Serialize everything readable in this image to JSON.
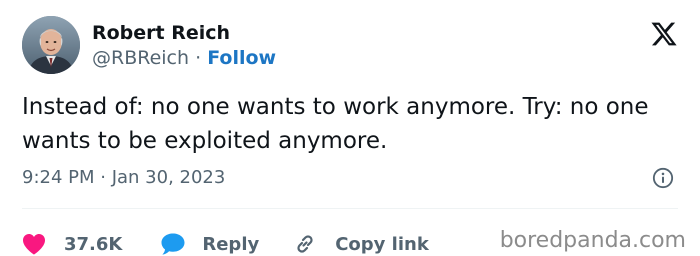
{
  "author": {
    "name": "Robert Reich",
    "handle": "@RBReich",
    "separator": "·",
    "follow_label": "Follow"
  },
  "tweet": {
    "text": "Instead of: no one wants to work anymore. Try: no one wants to be exploited anymore.",
    "timestamp": "9:24 PM · Jan 30, 2023"
  },
  "actions": {
    "like_count": "37.6K",
    "reply_label": "Reply",
    "copy_link_label": "Copy link"
  },
  "watermark": "boredpanda.com",
  "icons": {
    "brand": "x-logo-icon",
    "like": "heart-icon",
    "reply": "speech-bubble-icon",
    "copy_link": "link-icon",
    "info": "info-icon"
  },
  "colors": {
    "follow": "#1d76c4",
    "heart": "#f91880",
    "reply": "#1d9bf0",
    "secondary_text": "#536471"
  }
}
